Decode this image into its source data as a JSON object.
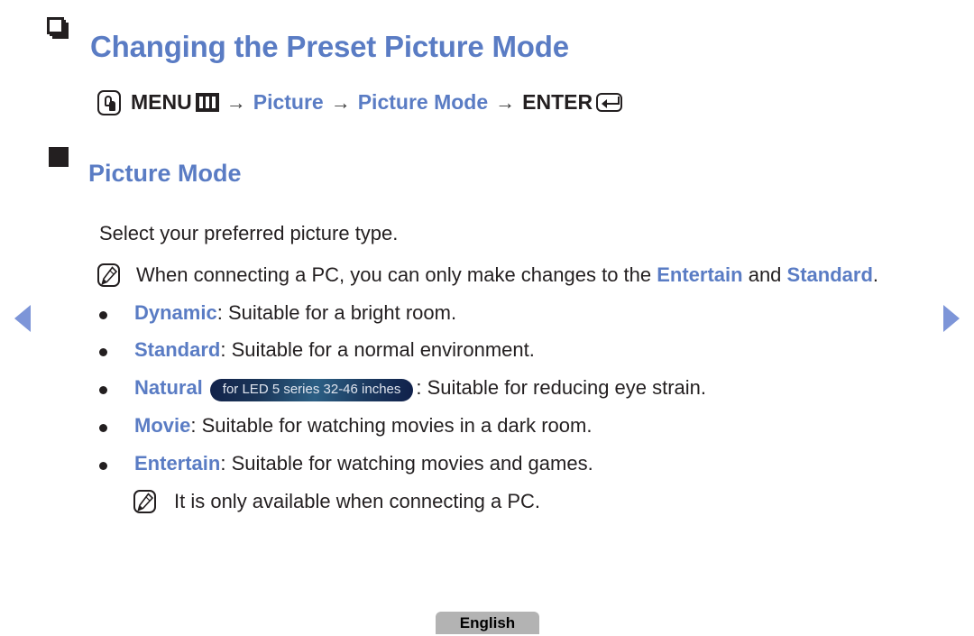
{
  "document": {
    "heading": "Changing the Preset Picture Mode",
    "menu_path": {
      "touch_icon": "touch-hand-icon",
      "menu_label": "MENU",
      "menu_icon": "menu-bars-icon",
      "arrow": "→",
      "step1": "Picture",
      "step2": "Picture Mode",
      "enter_label": "ENTER",
      "enter_icon": "enter-return-icon"
    },
    "section": {
      "title": "Picture Mode",
      "intro": "Select your preferred picture type."
    },
    "note_top": {
      "icon": "note-pencil-icon",
      "part1": "When connecting a PC, you can only make changes to the ",
      "kw1": "Entertain",
      "part2": " and ",
      "kw2": "Standard",
      "part3": "."
    },
    "modes": [
      {
        "name": "Dynamic",
        "badge": "",
        "desc": ": Suitable for a bright room."
      },
      {
        "name": "Standard",
        "badge": "",
        "desc": ": Suitable for a normal environment."
      },
      {
        "name": "Natural",
        "badge": "for LED 5 series 32-46 inches",
        "desc": ": Suitable for reducing eye strain."
      },
      {
        "name": "Movie",
        "badge": "",
        "desc": ": Suitable for watching movies in a dark room."
      },
      {
        "name": "Entertain",
        "badge": "",
        "desc": ": Suitable for watching movies and games."
      }
    ],
    "note_sub": {
      "icon": "note-pencil-icon",
      "text": "It is only available when connecting a PC."
    },
    "footer": {
      "language_label": "English"
    },
    "nav": {
      "prev_icon": "prev-page-arrow",
      "next_icon": "next-page-arrow"
    },
    "colors": {
      "accent_blue": "#5a7cc4",
      "arrow_blue": "#7d95d8",
      "text_dark": "#231f20",
      "badge_dark": "#12224a",
      "footer_gray": "#b3b3b3"
    }
  }
}
